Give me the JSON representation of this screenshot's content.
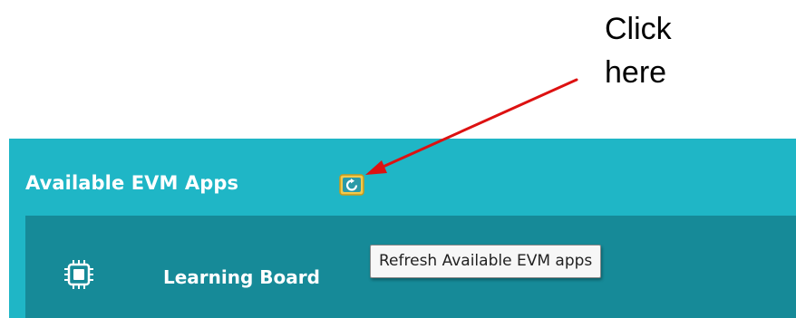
{
  "annotation": {
    "lines": [
      "Click",
      "here"
    ],
    "arrow_color": "#dd1111"
  },
  "panel": {
    "title": "Available EVM Apps",
    "background_color": "#1fb6c6",
    "list_background_color": "#168a98",
    "refresh_button": {
      "icon": "refresh-icon",
      "tooltip": "Refresh Available EVM apps"
    },
    "apps": [
      {
        "label": "Learning Board",
        "icon": "chip-icon"
      }
    ]
  }
}
